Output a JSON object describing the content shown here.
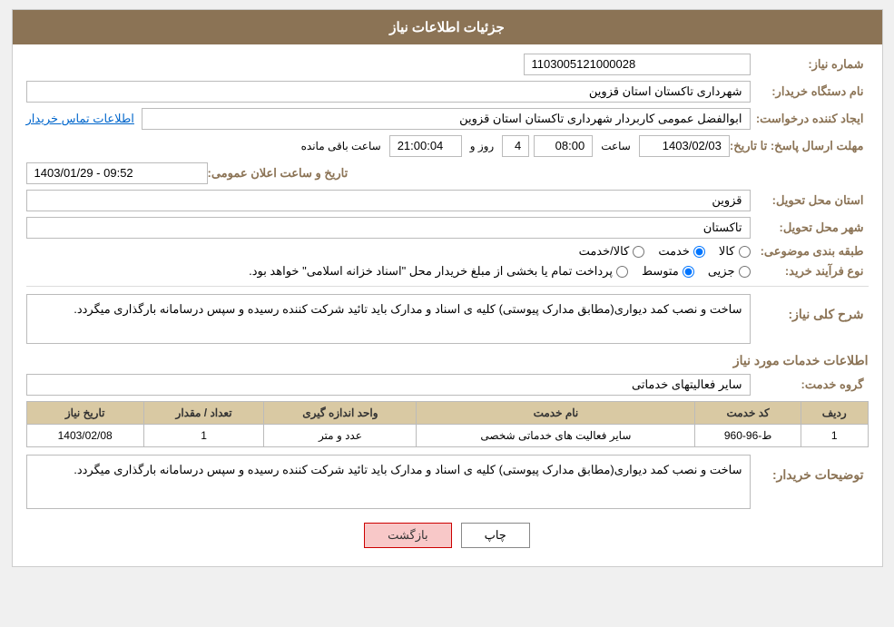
{
  "header": {
    "title": "جزئیات اطلاعات نیاز"
  },
  "fields": {
    "need_number_label": "شماره نیاز:",
    "need_number_value": "1103005121000028",
    "org_name_label": "نام دستگاه خریدار:",
    "org_name_value": "شهرداری تاکستان استان قزوین",
    "creator_label": "ایجاد کننده درخواست:",
    "creator_value": "ابوالفضل عمومی کاربردار شهرداری تاکستان استان قزوین",
    "creator_link": "اطلاعات تماس خریدار",
    "deadline_label": "مهلت ارسال پاسخ: تا تاریخ:",
    "deadline_date": "1403/02/03",
    "deadline_time_label": "ساعت",
    "deadline_time": "08:00",
    "deadline_days_label": "روز و",
    "deadline_days": "4",
    "deadline_remaining_label": "ساعت باقی مانده",
    "deadline_remaining": "21:00:04",
    "delivery_province_label": "استان محل تحویل:",
    "delivery_province_value": "قزوین",
    "delivery_city_label": "شهر محل تحویل:",
    "delivery_city_value": "تاکستان",
    "category_label": "طبقه بندی موضوعی:",
    "category_options": [
      "کالا",
      "خدمت",
      "کالا/خدمت"
    ],
    "category_selected": "خدمت",
    "purchase_type_label": "نوع فرآیند خرید:",
    "purchase_type_options": [
      "جزیی",
      "متوسط",
      "پرداخت تمام یا بخشی از مبلغ خریدار محل \"اسناد خزانه اسلامی\" خواهد بود."
    ],
    "purchase_type_selected": "متوسط",
    "announce_label": "تاریخ و ساعت اعلان عمومی:",
    "announce_value": "1403/01/29 - 09:52",
    "general_desc_label": "شرح کلی نیاز:",
    "general_desc_value": "ساخت و نصب کمد دیواری(مطابق مدارک پیوستی) کلیه ی اسناد و مدارک باید تائید شرکت کننده رسیده و سپس درسامانه بارگذاری میگردد.",
    "services_info_title": "اطلاعات خدمات مورد نیاز",
    "service_group_label": "گروه خدمت:",
    "service_group_value": "سایر فعالیتهای خدماتی",
    "table": {
      "headers": [
        "ردیف",
        "کد خدمت",
        "نام خدمت",
        "واحد اندازه گیری",
        "تعداد / مقدار",
        "تاریخ نیاز"
      ],
      "rows": [
        {
          "row": "1",
          "code": "ط-96-960",
          "name": "سایر فعالیت های خدماتی شخصی",
          "unit": "عدد و متر",
          "quantity": "1",
          "date": "1403/02/08"
        }
      ]
    },
    "buyer_desc_label": "توضیحات خریدار:",
    "buyer_desc_value": "ساخت و نصب کمد دیواری(مطابق مدارک پیوستی) کلیه ی اسناد و مدارک باید تائید شرکت کننده رسیده و سپس درسامانه بارگذاری میگردد."
  },
  "buttons": {
    "print_label": "چاپ",
    "back_label": "بازگشت"
  }
}
